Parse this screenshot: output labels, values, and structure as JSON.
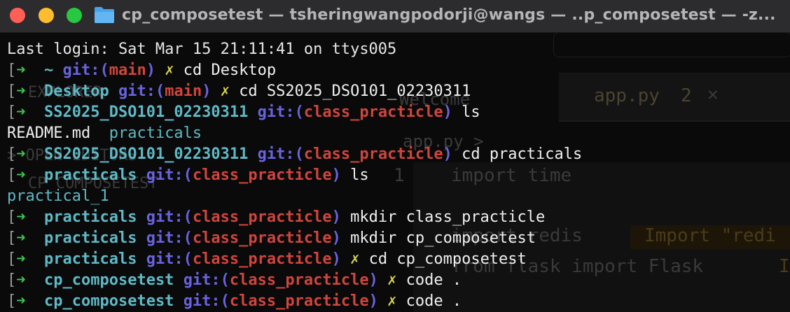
{
  "window": {
    "title": "cp_composetest — tsheringwangpodorji@wangs — ..p_composetest — -z..."
  },
  "colors": {
    "dir": "#5fb9c6",
    "git": "#6a63e0",
    "branch": "#d0453d",
    "arrow": "#3ec453",
    "dirty": "#d8d449"
  },
  "ghost": {
    "explorer": "EXPLORER",
    "welcome": "Welcome",
    "tab_file": "app.py",
    "tab_count": "2",
    "tab_close": "✕",
    "breadcrumb": "app.py >",
    "open_editors": "> OPEN EDITORS",
    "folder": "CP_COMPOSETEST",
    "line_num": "1",
    "code1": "import time",
    "code2": "import redis",
    "code3": "from flask import Flask",
    "warn": "Import \"redi",
    "tail": "I"
  },
  "terminal": {
    "login": "Last login: Sat Mar 15 21:11:41 on ttys005",
    "bracket": "[",
    "arrow": "➜",
    "git": "git:(",
    "git_close": ")",
    "dirty": "✗",
    "lines": [
      {
        "dir": "~",
        "branch": "main",
        "dirty": true,
        "cmd": "cd Desktop"
      },
      {
        "dir": "Desktop",
        "branch": "main",
        "dirty": true,
        "cmd": "cd SS2025_DSO101_02230311"
      },
      {
        "dir": "SS2025_DSO101_02230311",
        "branch": "class_practicle",
        "dirty": false,
        "cmd": "ls"
      },
      {
        "output": [
          {
            "text": "README.md",
            "cls": "plain"
          },
          {
            "text": "  ",
            "cls": "plain"
          },
          {
            "text": "practicals",
            "cls": "cyan"
          }
        ]
      },
      {
        "dir": "SS2025_DSO101_02230311",
        "branch": "class_practicle",
        "dirty": false,
        "cmd": "cd practicals"
      },
      {
        "dir": "practicals",
        "branch": "class_practicle",
        "dirty": false,
        "cmd": "ls"
      },
      {
        "output": [
          {
            "text": "practical_1",
            "cls": "cyan"
          }
        ]
      },
      {
        "dir": "practicals",
        "branch": "class_practicle",
        "dirty": false,
        "cmd": "mkdir class_practicle"
      },
      {
        "dir": "practicals",
        "branch": "class_practicle",
        "dirty": false,
        "cmd": "mkdir cp_composetest"
      },
      {
        "dir": "practicals",
        "branch": "class_practicle",
        "dirty": true,
        "cmd": "cd cp_composetest"
      },
      {
        "dir": "cp_composetest",
        "branch": "class_practicle",
        "dirty": true,
        "cmd": "code ."
      },
      {
        "dir": "cp_composetest",
        "branch": "class_practicle",
        "dirty": true,
        "cmd": "code ."
      }
    ]
  }
}
